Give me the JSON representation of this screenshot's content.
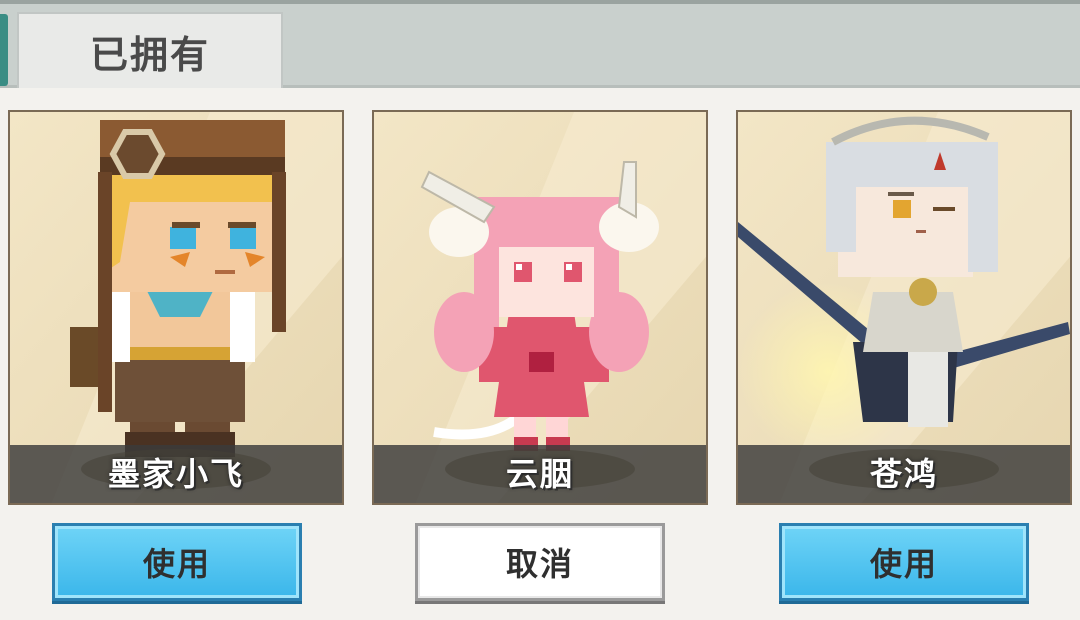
{
  "tabs": {
    "owned_label": "已拥有"
  },
  "skins": [
    {
      "name": "墨家小飞",
      "button_label": "使用",
      "button_style": "blue"
    },
    {
      "name": "云胭",
      "button_label": "取消",
      "button_style": "white"
    },
    {
      "name": "苍鸿",
      "button_label": "使用",
      "button_style": "blue"
    }
  ],
  "colors": {
    "accent_blue": "#3ab6ea",
    "topbar": "#c9d0cd",
    "card_bg": "#efe2c2",
    "card_border": "#7a6a55"
  },
  "icons": [
    "character-mojia-xiaofei-image",
    "character-yunyan-image",
    "character-canghong-image"
  ]
}
